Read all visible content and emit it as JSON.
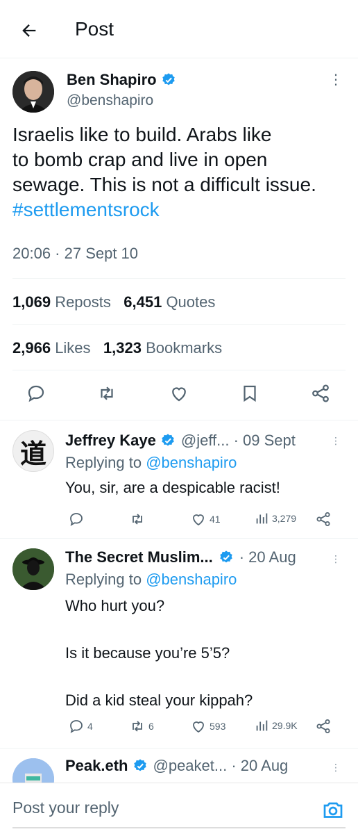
{
  "header": {
    "title": "Post"
  },
  "post": {
    "author_name": "Ben Shapiro",
    "author_handle": "@benshapiro",
    "text_line1": "Israelis like to build. Arabs like",
    "text_line2": "to bomb crap and live in open",
    "text_line3": "sewage. This is not a difficult issue.",
    "hashtag": "#settlementsrock",
    "timestamp": "20:06 · 27 Sept 10",
    "reposts_count": "1,069",
    "reposts_label": "Reposts",
    "quotes_count": "6,451",
    "quotes_label": "Quotes",
    "likes_count": "2,966",
    "likes_label": "Likes",
    "bookmarks_count": "1,323",
    "bookmarks_label": "Bookmarks"
  },
  "replies": [
    {
      "name": "Jeffrey Kaye",
      "meta": "@jeff... · 09 Sept",
      "replying_prefix": "Replying to ",
      "replying_to": "@benshapiro",
      "text": "You, sir, are a despicable racist!",
      "avatar_glyph": "道",
      "replies": "",
      "reposts": "",
      "likes": "41",
      "views": "3,279"
    },
    {
      "name": "The Secret Muslim...",
      "meta": "· 20 Aug",
      "replying_prefix": "Replying to ",
      "replying_to": "@benshapiro",
      "text_line1": "Who hurt you?",
      "text_line2": "Is it because you’re 5’5?",
      "text_line3": "Did a kid steal your kippah?",
      "replies": "4",
      "reposts": "6",
      "likes": "593",
      "views": "29.9K"
    },
    {
      "name": "Peak.eth",
      "meta": "@peaket... · 20 Aug"
    }
  ],
  "composer": {
    "placeholder": "Post your reply"
  },
  "colors": {
    "accent": "#1d9bf0",
    "muted": "#536471",
    "text": "#0f1419"
  }
}
